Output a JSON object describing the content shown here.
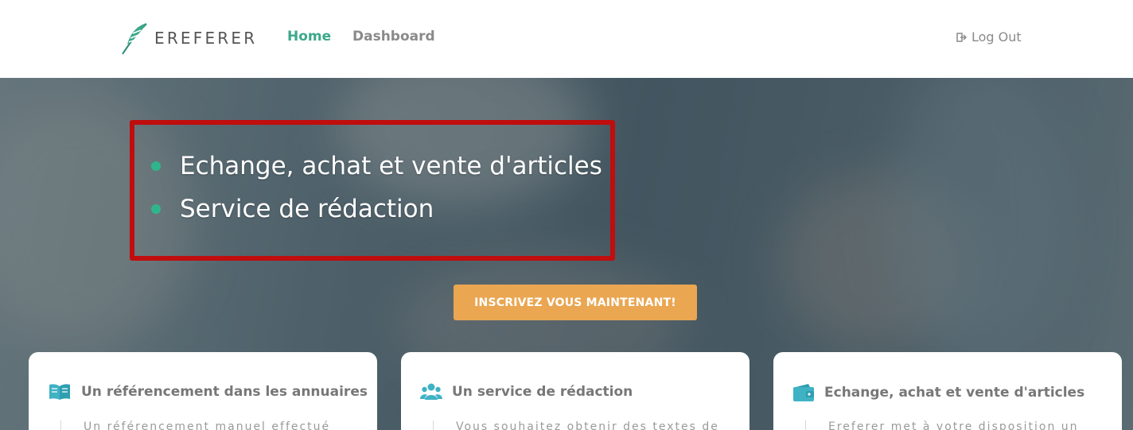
{
  "nav": {
    "brand": "EREFERER",
    "home": "Home",
    "dashboard": "Dashboard",
    "logout": "Log Out"
  },
  "hero": {
    "bullets": [
      "Echange, achat et vente d'articles",
      "Service de rédaction"
    ],
    "cta": "INSCRIVEZ VOUS MAINTENANT!"
  },
  "cards": [
    {
      "icon": "open-book-icon",
      "title": "Un référencement dans les annuaires",
      "text": "Un référencement manuel effectué"
    },
    {
      "icon": "users-icon",
      "title": "Un service de rédaction",
      "text": "Vous souhaitez obtenir des textes de"
    },
    {
      "icon": "wallet-icon",
      "title": "Echange, achat et vente d'articles",
      "text": "Ereferer met à votre disposition un"
    }
  ],
  "colors": {
    "accent": "#3ba88a",
    "cta": "#eaa651",
    "highlight_border": "#c00d0d",
    "bullet": "#2fb58c"
  }
}
